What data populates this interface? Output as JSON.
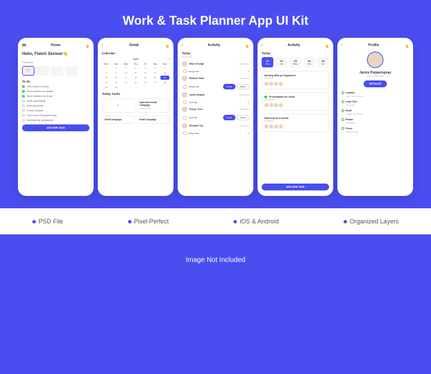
{
  "title": "Work & Task Planner App UI Kit",
  "features": [
    "PSD File",
    "Pixel Perfect",
    "iOS & Android",
    "Organized Layers"
  ],
  "footer": "Image Not Included",
  "screen1": {
    "header": "Home",
    "greeting": "Hello, Fletch Skinner👋",
    "favourite_label": "Favourite",
    "todo_label": "To do",
    "todos_done": [
      "Kids' practice photos",
      "Home repairs as needed",
      "Send invitation by email"
    ],
    "todos_open": [
      "Invite participants",
      "Rent payments",
      "Check archives",
      "Get it from bill payment plan",
      "Business trip preparation"
    ],
    "cta": "ADD NEW TASK"
  },
  "screen2": {
    "header": "Detail",
    "calendar_label": "Calendar",
    "month": "April",
    "day_headers": [
      "Mon",
      "Tue",
      "Wed",
      "Thu",
      "Fri",
      "Sat",
      "Sun"
    ],
    "today_tasks_label": "Today Tasks",
    "task1": {
      "title": "Implement Email Campaign",
      "time": "12:00 - 13:30"
    },
    "task2": {
      "title": "Email Campaign",
      "time": ""
    },
    "task3": {
      "title": "Email Campaign",
      "time": ""
    }
  },
  "screen3": {
    "header": "Activity",
    "today": "Today",
    "date": "10.04.2022",
    "items": [
      {
        "name": "Ravi O'Leigh",
        "time": "18:30:2022",
        "file": "Design File"
      },
      {
        "name": "Eleanor Fant",
        "time": "18:30:2022",
        "file": "Design File",
        "actions": true
      },
      {
        "name": "Lance Bogrol",
        "time": "18:30:2022",
        "file": "Icons File"
      },
      {
        "name": "Penny Tool",
        "time": "18:30:2022",
        "file": "Icons File",
        "actions": true
      },
      {
        "name": "Richard Tea",
        "time": "11:09:2022",
        "file": "Photos File"
      }
    ],
    "accept": "Accept",
    "reject": "Reject"
  },
  "screen4": {
    "header": "Activity",
    "today": "Today",
    "dates": [
      {
        "num": "21",
        "day": "Mon"
      },
      {
        "num": "22",
        "day": "Tue"
      },
      {
        "num": "23",
        "day": "Wed"
      },
      {
        "num": "24",
        "day": "Thu"
      },
      {
        "num": "25",
        "day": "Fri"
      }
    ],
    "meetings": [
      {
        "title": "Meeting With pr Deparment",
        "time": "18:30:2022"
      },
      {
        "title": "Presentation for client",
        "time": "18:30:2022",
        "done": true
      },
      {
        "title": "Planning for a month",
        "time": "18:30:2022"
      }
    ],
    "cta": "ADD NEW TASK"
  },
  "screen5": {
    "header": "Profile",
    "name": "Jarvis Pepperspray",
    "role": "UX/UI DESIGNER",
    "msg": "MESSAGE",
    "info": [
      {
        "label": "Location",
        "val": "2497 James Avenue"
      },
      {
        "label": "Local Time",
        "val": "07:20 AM"
      },
      {
        "label": "Email",
        "val": "gkaplan@mac.com"
      },
      {
        "label": "Photos",
        "val": "16 Photos"
      },
      {
        "label": "Phone",
        "val": "315-221-8313"
      }
    ]
  }
}
